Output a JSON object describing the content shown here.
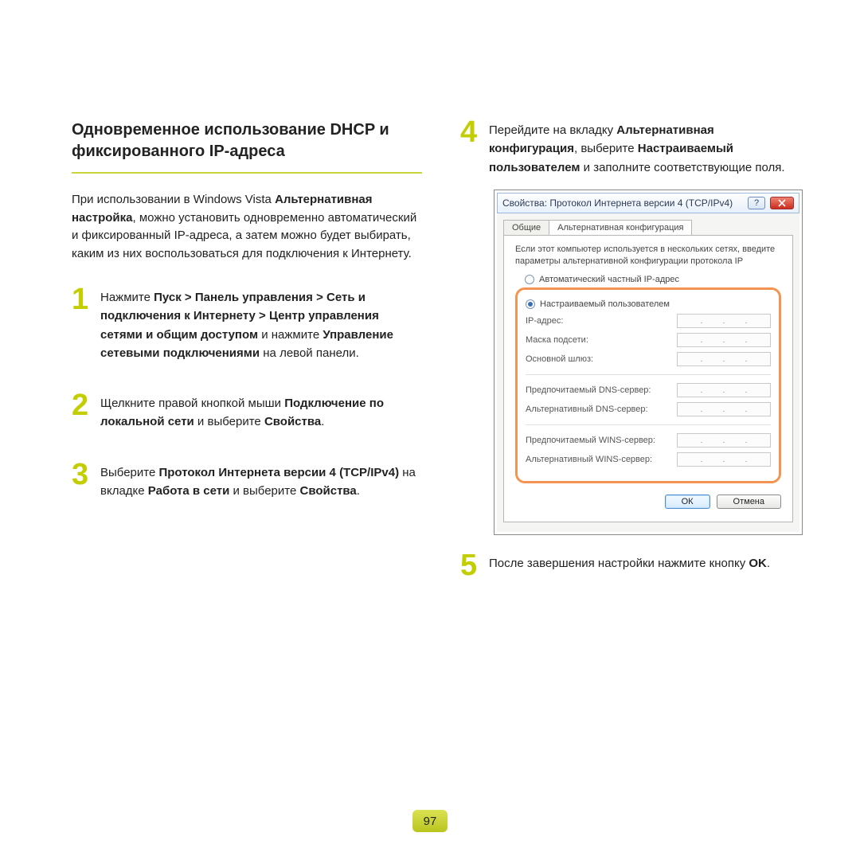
{
  "title": "Одновременное использование DHCP и фиксированного IP-адреса",
  "intro": {
    "pre": "При использовании в Windows Vista ",
    "b1": "Альтернативная настройка",
    "post": ", можно установить одновременно автоматический и фиксированный IP-адреса, а затем можно будет выбирать, каким из них воспользоваться для подключения к Интернету."
  },
  "steps": {
    "s1": {
      "num": "1",
      "t1": "Нажмите ",
      "b1": "Пуск > Панель управления > Сеть и подключения к Интернету > Центр управления сетями и общим доступом",
      "t2": " и нажмите ",
      "b2": "Управление сетевыми подключениями",
      "t3": " на левой панели."
    },
    "s2": {
      "num": "2",
      "t1": "Щелкните правой кнопкой мыши ",
      "b1": "Подключение по локальной сети",
      "t2": " и выберите ",
      "b2": "Свойства",
      "t3": "."
    },
    "s3": {
      "num": "3",
      "t1": "Выберите ",
      "b1": "Протокол Интернета версии 4 (TCP/IPv4)",
      "t2": " на вкладке ",
      "b2": "Работа в сети",
      "t3": " и выберите ",
      "b3": "Свойства",
      "t4": "."
    },
    "s4": {
      "num": "4",
      "t1": "Перейдите на вкладку ",
      "b1": "Альтернативная конфигурация",
      "t2": ", выберите ",
      "b2": "Настраиваемый пользователем",
      "t3": " и заполните соответствующие поля."
    },
    "s5": {
      "num": "5",
      "t1": "После завершения настройки нажмите кнопку ",
      "b1": "OK",
      "t2": "."
    }
  },
  "dialog": {
    "title": "Свойства: Протокол Интернета версии 4 (TCP/IPv4)",
    "tab_general": "Общие",
    "tab_alt": "Альтернативная конфигурация",
    "hint": "Если этот компьютер используется в нескольких сетях, введите параметры альтернативной конфигурации протокола IP",
    "radio_auto": "Автоматический частный IP-адрес",
    "radio_user": "Настраиваемый пользователем",
    "fields": {
      "ip": "IP-адрес:",
      "mask": "Маска подсети:",
      "gw": "Основной шлюз:",
      "dns1": "Предпочитаемый DNS-сервер:",
      "dns2": "Альтернативный DNS-сервер:",
      "wins1": "Предпочитаемый WINS-сервер:",
      "wins2": "Альтернативный WINS-сервер:"
    },
    "ok": "ОК",
    "cancel": "Отмена"
  },
  "page_num": "97"
}
